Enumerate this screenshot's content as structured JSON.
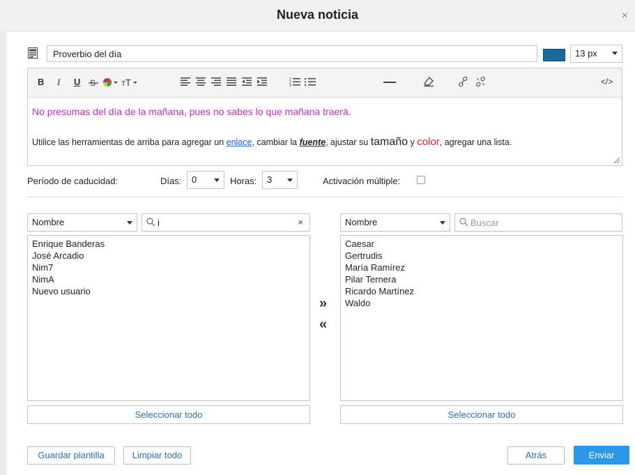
{
  "dialog": {
    "title": "Nueva noticia",
    "close": "×"
  },
  "subject": {
    "value": "Proverbio del día"
  },
  "font": {
    "color": "#1a6a9e",
    "size": "13 px"
  },
  "toolbar": {
    "bold": "B",
    "italic": "I",
    "underline": "U",
    "buttons": [
      "bold",
      "italic",
      "underline",
      "strikethrough",
      "text-color",
      "font-size",
      "align-left",
      "align-center",
      "align-right",
      "align-justify",
      "outdent",
      "indent",
      "ordered-list",
      "unordered-list",
      "horizontal-rule",
      "eraser",
      "link",
      "unlink",
      "source-code"
    ],
    "source": "</>"
  },
  "editor": {
    "line1": "No presumas del día de la mañana, pues no sabes lo que mañana traerá.",
    "line2": {
      "p1": "Utilice las herramientas de arriba para agregar un ",
      "link": "enlace",
      "p2": ", cambiar la ",
      "fuente": "fuente",
      "p3": ", ajustar su ",
      "tamano": "tamaño",
      "p4": " y ",
      "color": "color",
      "p5": ", agregar una lista."
    },
    "line1_color": "#c22cc2",
    "link_color": "#1a5fd0",
    "color_word_color": "#e0232a"
  },
  "expiry": {
    "label": "Período de caducidad:",
    "days_label": "Días:",
    "days_value": "0",
    "hours_label": "Horas:",
    "hours_value": "3",
    "multiple_label": "Activación múltiple:",
    "multiple_checked": false
  },
  "left_panel": {
    "filter": "Nombre",
    "search_value": "i",
    "search_clear": "×",
    "items": [
      "Enrique Banderas",
      "José Arcadio",
      "Nim7",
      "NimA",
      "Nuevo usuario"
    ],
    "select_all": "Seleccionar todo"
  },
  "transfer": {
    "right": "»",
    "left": "«"
  },
  "right_panel": {
    "filter": "Nombre",
    "search_placeholder": "Buscar",
    "items": [
      "Caesar",
      "Gertrudis",
      "María Ramírez",
      "Pilar Ternera",
      "Ricardo Martínez",
      "Waldo"
    ],
    "select_all": "Seleccionar todo"
  },
  "footer": {
    "save_template": "Guardar plantilla",
    "clear_all": "Limpiar todo",
    "back": "Atrás",
    "send": "Enviar"
  },
  "colors": {
    "accent": "#2c98e8",
    "link_button_text": "#2a6eb0"
  }
}
